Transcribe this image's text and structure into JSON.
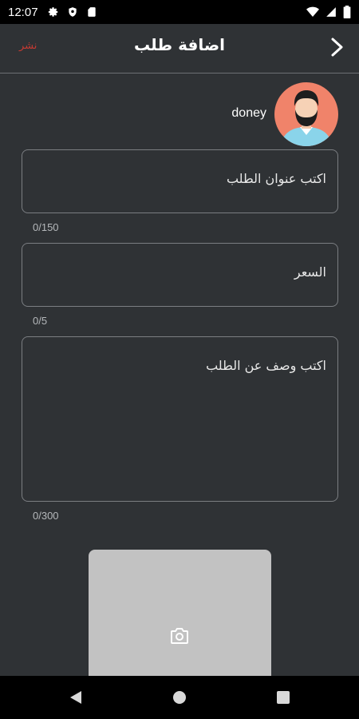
{
  "status_bar": {
    "time": "12:07"
  },
  "app_bar": {
    "title": "اضافة طلب",
    "publish_label": "نشر"
  },
  "user": {
    "name": "doney"
  },
  "form": {
    "title_placeholder": "اكتب عنوان  الطلب",
    "title_counter": "0/150",
    "price_placeholder": "السعر",
    "price_counter": "0/5",
    "description_placeholder": "اكتب وصف عن الطلب",
    "description_counter": "0/300"
  },
  "colors": {
    "background": "#2f3235",
    "publish": "#c43a32",
    "avatar_bg": "#f0836a",
    "image_picker_bg": "#c2c2c2"
  }
}
